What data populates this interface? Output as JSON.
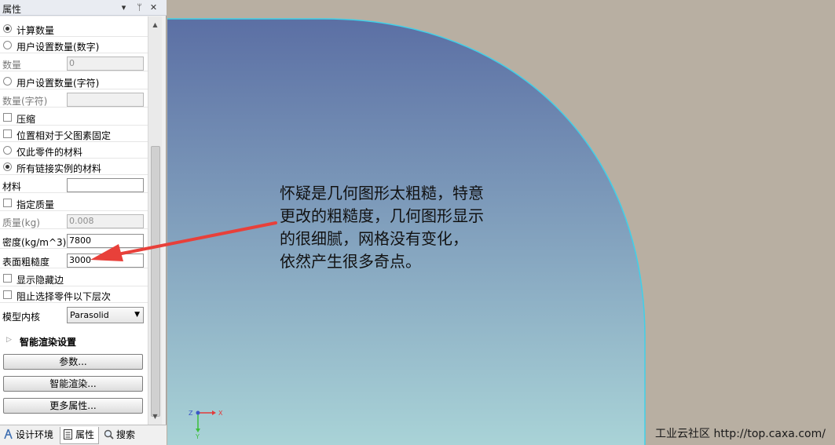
{
  "panel": {
    "title": "属性",
    "header_buttons": {
      "dropdown": "▾",
      "pin": "ᛘ",
      "close": "✕"
    },
    "rows": {
      "calc_count": "计算数量",
      "user_count_number": "用户设置数量(数字)",
      "count_label": "数量",
      "count_value": "0",
      "user_count_text": "用户设置数量(字符)",
      "count_text_label": "数量(字符)",
      "count_text_value": "",
      "compress": "压缩",
      "fixed_to_parent": "位置相对于父图素固定",
      "part_material_only": "仅此零件的材料",
      "all_linked_material": "所有链接实例的材料",
      "material_label": "材料",
      "material_value": "",
      "specify_mass": "指定质量",
      "mass_label": "质量(kg)",
      "mass_value": "0.008",
      "density_label": "密度(kg/m^3)",
      "density_value": "7800",
      "roughness_label": "表面粗糙度",
      "roughness_value": "3000",
      "show_hidden_edges": "显示隐藏边",
      "block_lower_levels": "阻止选择零件以下层次",
      "kernel_label": "模型内核",
      "kernel_value": "Parasolid"
    },
    "section": {
      "smart_render_settings": "智能渲染设置"
    },
    "buttons": {
      "params": "参数...",
      "smart_render": "智能渲染...",
      "more_props": "更多属性..."
    },
    "tabs": {
      "design_env": "设计环境",
      "properties": "属性",
      "search": "搜索"
    }
  },
  "viewport": {
    "annotation": "怀疑是几何图形太粗糙，特意\n更改的粗糙度，几何图形显示\n的很细腻，网格没有变化，\n依然产生很多奇点。",
    "triad": {
      "x": "X",
      "y": "Y",
      "z": "Z"
    },
    "watermark": "工业云社区 http://top.caxa.com/",
    "colors": {
      "background": "#b8afa2",
      "gradient_top": "#5b6fa4",
      "gradient_bottom": "#a9d3d7",
      "edge": "#40d0e8",
      "arrow": "#e8403a"
    }
  }
}
